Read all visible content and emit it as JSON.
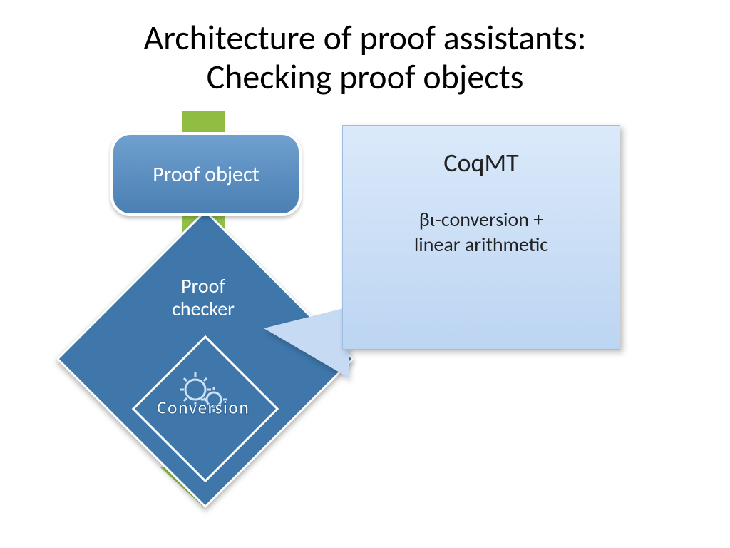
{
  "title_line1": "Architecture of proof assistants:",
  "title_line2": "Checking proof objects",
  "nodes": {
    "proof_object": "Proof object",
    "proof_checker_l1": "Proof",
    "proof_checker_l2": "checker",
    "conversion": "Conversion"
  },
  "callout": {
    "title": "CoqMT",
    "body_l1": "βι-conversion +",
    "body_l2": "linear arithmetic"
  },
  "colors": {
    "box_blue": "#4b7fb3",
    "diamond_blue": "#3f77ab",
    "arrow_green": "#9fcf50",
    "callout_bg_top": "#dbe9fa",
    "callout_bg_bottom": "#bcd5f2"
  },
  "icon": "gears-icon"
}
